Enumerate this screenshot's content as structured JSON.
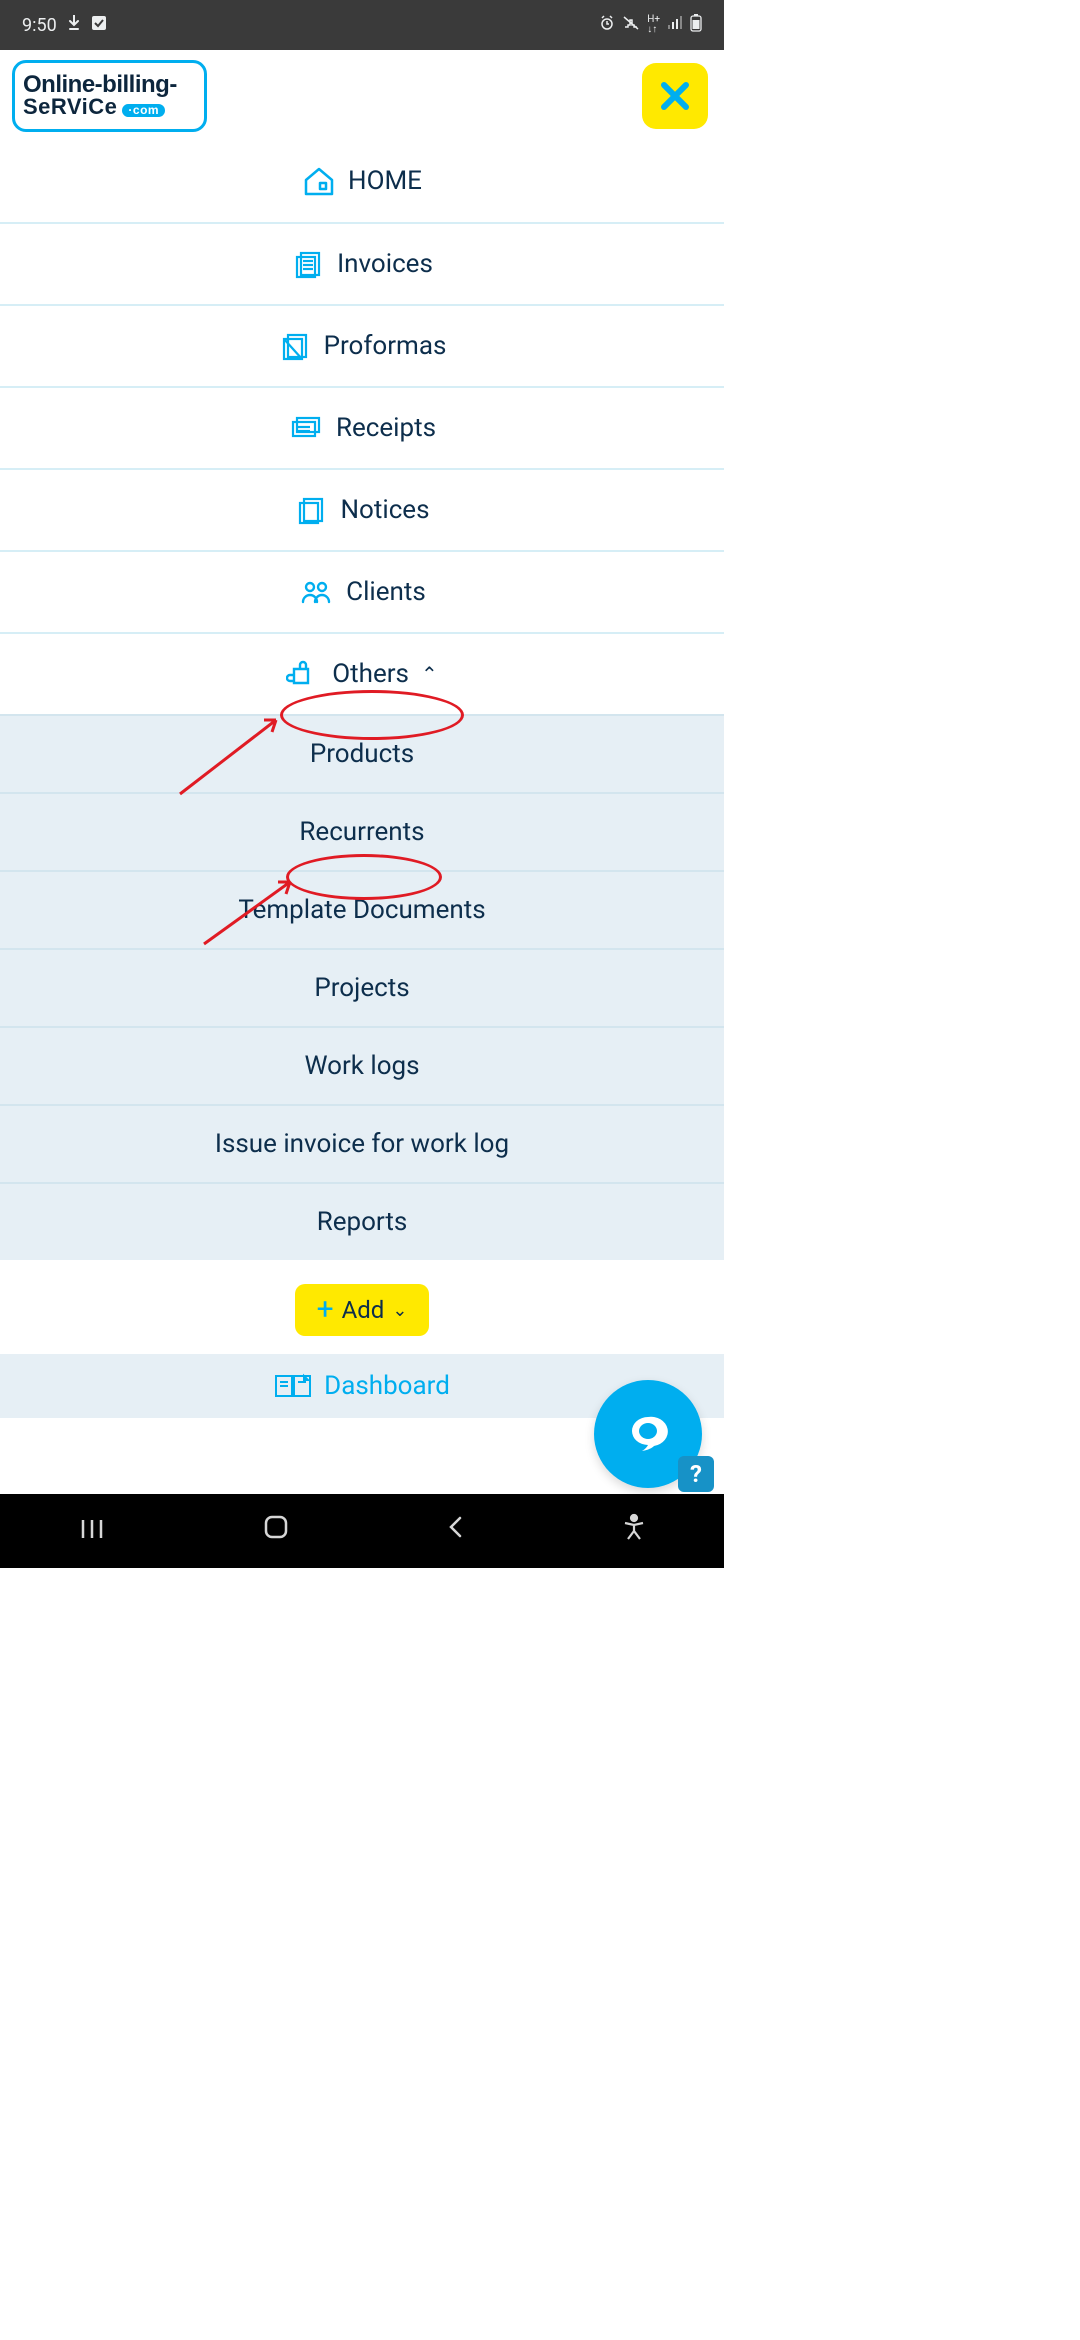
{
  "status": {
    "time": "9:50"
  },
  "logo": {
    "line1": "Online-billing-",
    "line2": "SeRViCe",
    "suffix": "·com"
  },
  "nav": [
    {
      "label": "HOME",
      "icon": "home-icon"
    },
    {
      "label": "Invoices",
      "icon": "invoices-icon"
    },
    {
      "label": "Proformas",
      "icon": "proformas-icon"
    },
    {
      "label": "Receipts",
      "icon": "receipts-icon"
    },
    {
      "label": "Notices",
      "icon": "notices-icon"
    },
    {
      "label": "Clients",
      "icon": "clients-icon"
    },
    {
      "label": "Others",
      "icon": "others-icon",
      "expanded": true
    }
  ],
  "sub": [
    {
      "label": "Products"
    },
    {
      "label": "Recurrents"
    },
    {
      "label": "Template Documents"
    },
    {
      "label": "Projects"
    },
    {
      "label": "Work logs"
    },
    {
      "label": "Issue invoice for work log"
    },
    {
      "label": "Reports"
    }
  ],
  "add": {
    "label": "Add"
  },
  "dashboard": {
    "label": "Dashboard"
  },
  "help": {
    "label": "?"
  }
}
